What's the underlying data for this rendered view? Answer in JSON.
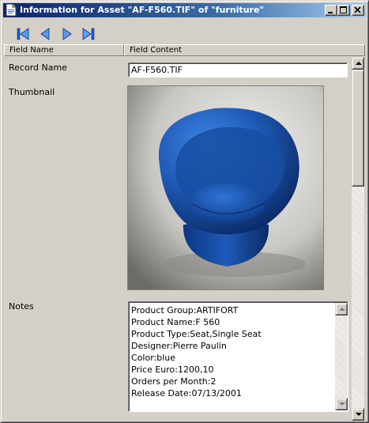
{
  "window": {
    "title": "Information for Asset \"AF-F560.TIF\" of \"furniture\"",
    "controls": [
      "minimize",
      "maximize",
      "close"
    ]
  },
  "toolbar": {
    "buttons": [
      {
        "name": "first-record",
        "icon": "skip-first-icon"
      },
      {
        "name": "previous-record",
        "icon": "triangle-left-icon"
      },
      {
        "name": "next-record",
        "icon": "triangle-right-icon"
      },
      {
        "name": "last-record",
        "icon": "skip-last-icon"
      }
    ]
  },
  "columns": {
    "field_name": "Field Name",
    "field_content": "Field Content"
  },
  "fields": {
    "record_name": {
      "label": "Record Name",
      "value": "AF-F560.TIF"
    },
    "thumbnail": {
      "label": "Thumbnail",
      "image": "blue mushroom chair"
    },
    "notes": {
      "label": "Notes",
      "lines": [
        "Product Group:ARTIFORT",
        "Product Name:F 560",
        "Product Type:Seat,Single Seat",
        "Designer:Pierre Paulin",
        "Color:blue",
        "Price Euro:1200,10",
        "Orders per Month:2",
        "Release Date:07/13/2001"
      ]
    }
  },
  "colors": {
    "title_bar_start": "#0a246a",
    "title_bar_end": "#a6caf0",
    "nav_icon": "#1e5fd6",
    "chair_blue": "#1f5bb8"
  }
}
